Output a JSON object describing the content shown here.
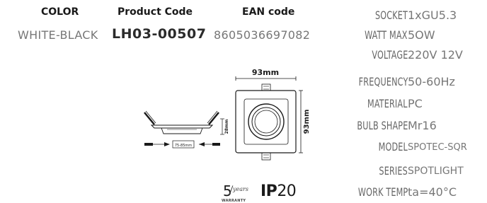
{
  "header": {
    "color_label": "COLOR",
    "code_label": "Product Code",
    "ean_label": "EAN code"
  },
  "product": {
    "color": "WHITE-BLACK",
    "code": "LH03-00507",
    "ean": "8605036697082"
  },
  "specs": [
    {
      "key": "SOCKET",
      "value": "1xGU5.3"
    },
    {
      "key": "WATT MAX",
      "value": "5OW"
    },
    {
      "key": "VOLTAGE",
      "value": "220V 12V"
    },
    {
      "key": "FREQUENCY",
      "value": "50-60Hz"
    },
    {
      "key": "MATERIAL",
      "value": "PC"
    },
    {
      "key": "BULB SHAPE",
      "value": "Mr16"
    },
    {
      "key": "MODEL",
      "value": "SPOTEC-SQR"
    },
    {
      "key": "SERIES",
      "value": "SPOTLIGHT"
    },
    {
      "key": "WORK TEMP",
      "value": "ta=40°C"
    }
  ],
  "drawing": {
    "width_label": "93mm",
    "height_label": "93mm",
    "depth_label": "28mm",
    "cutout_label": "75-85mm"
  },
  "badges": {
    "warranty_number": "5",
    "warranty_unit": "years",
    "warranty_text": "WARRANTY",
    "ip_prefix": "IP",
    "ip_value": "20"
  }
}
